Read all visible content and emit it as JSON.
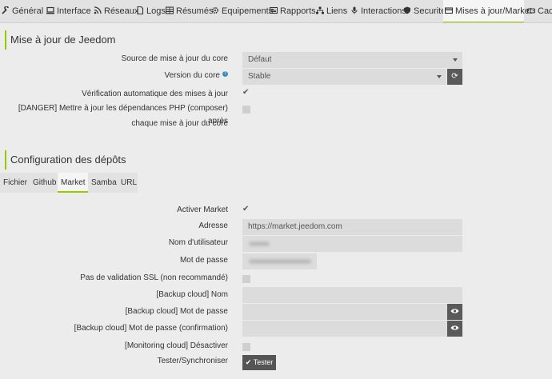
{
  "tabs": [
    {
      "label": "Général",
      "icon": "wrench-icon"
    },
    {
      "label": "Interface",
      "icon": "laptop-icon"
    },
    {
      "label": "Réseaux",
      "icon": "rss-icon"
    },
    {
      "label": "Logs",
      "icon": "file-icon"
    },
    {
      "label": "Résumés",
      "icon": "table-icon"
    },
    {
      "label": "Equipements",
      "icon": "cogs-icon"
    },
    {
      "label": "Rapports",
      "icon": "newspaper-icon"
    },
    {
      "label": "Liens",
      "icon": "sitemap-icon"
    },
    {
      "label": "Interactions",
      "icon": "microphone-icon"
    },
    {
      "label": "Securité",
      "icon": "shield-icon"
    },
    {
      "label": "Mises à jour/Market",
      "icon": "credit-card-icon"
    },
    {
      "label": "Cac",
      "icon": "hdd-icon"
    }
  ],
  "update_section": {
    "title": "Mise à jour de Jeedom",
    "source_label": "Source de mise à jour du core",
    "source_value": "Défaut",
    "version_label": "Version du core",
    "version_value": "Stable",
    "autocheck_label": "Vérification automatique des mises à jour",
    "autocheck_checked": true,
    "danger_label_line1": "[DANGER] Mettre à jour les dépendances PHP (composer) après",
    "danger_label_line2": "chaque mise à jour du core",
    "danger_checked": false
  },
  "repo_section": {
    "title": "Configuration des dépôts",
    "subtabs": [
      "Fichier",
      "Github",
      "Market",
      "Samba",
      "URL"
    ],
    "active_subtab": "Market",
    "activer_label": "Activer Market",
    "activer_checked": true,
    "adresse_label": "Adresse",
    "adresse_value": "https://market.jeedom.com",
    "user_label": "Nom d'utilisateur",
    "password_label": "Mot de passe",
    "ssl_label": "Pas de validation SSL (non recommandé)",
    "backup_name_label": "[Backup cloud] Nom",
    "backup_pw_label": "[Backup cloud] Mot de passe",
    "backup_pw_confirm_label": "[Backup cloud] Mot de passe (confirmation)",
    "monitoring_label": "[Monitoring cloud] Désactiver",
    "test_label": "Tester/Synchroniser",
    "test_button": "Tester"
  },
  "colors": {
    "accent": "#94ca02",
    "dark_button": "#555555"
  }
}
